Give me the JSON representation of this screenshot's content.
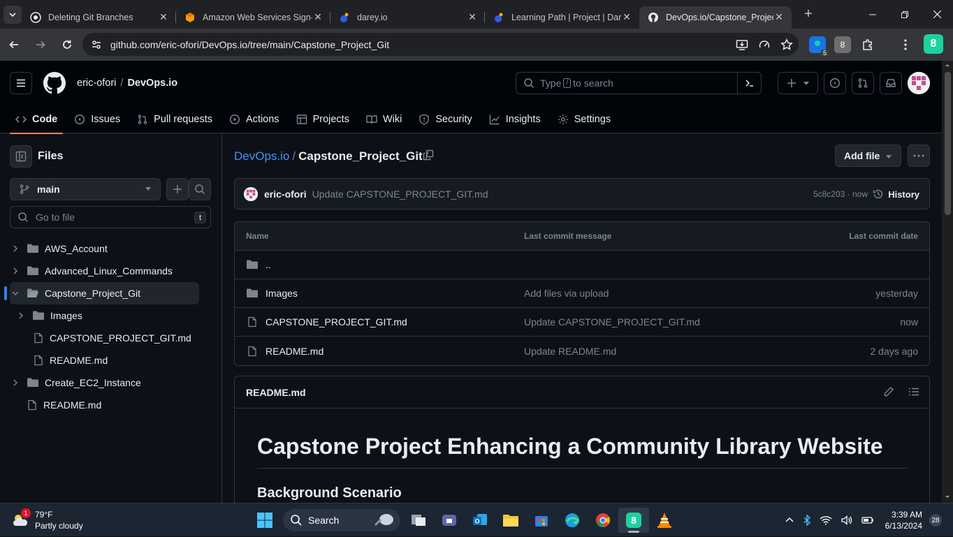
{
  "browser": {
    "tabs": [
      {
        "title": "Deleting Git Branches",
        "icon": "github-icon"
      },
      {
        "title": "Amazon Web Services Sign-In",
        "icon": "aws-icon"
      },
      {
        "title": "darey.io",
        "icon": "darey-icon"
      },
      {
        "title": "Learning Path | Project | Darey",
        "icon": "darey-icon"
      },
      {
        "title": "DevOps.io/Capstone_Project_Git",
        "icon": "github-icon",
        "active": true
      }
    ],
    "url": "github.com/eric-ofori/DevOps.io/tree/main/Capstone_Project_Git",
    "ext_badge": "5",
    "ext2_label": "8",
    "profile_label": "8"
  },
  "header": {
    "owner": "eric-ofori",
    "separator": "/",
    "repo": "DevOps.io",
    "search_prefix": "Type",
    "search_key": "/",
    "search_suffix": "to search"
  },
  "repo_tabs": [
    {
      "label": "Code",
      "icon": "code-icon",
      "active": true
    },
    {
      "label": "Issues",
      "icon": "issues-icon"
    },
    {
      "label": "Pull requests",
      "icon": "pull-request-icon"
    },
    {
      "label": "Actions",
      "icon": "play-icon"
    },
    {
      "label": "Projects",
      "icon": "table-icon"
    },
    {
      "label": "Wiki",
      "icon": "book-icon"
    },
    {
      "label": "Security",
      "icon": "shield-icon"
    },
    {
      "label": "Insights",
      "icon": "graph-icon"
    },
    {
      "label": "Settings",
      "icon": "gear-icon"
    }
  ],
  "sidebar": {
    "title": "Files",
    "branch": "main",
    "goto_placeholder": "Go to file",
    "goto_shortcut": "t",
    "tree": [
      {
        "label": "AWS_Account",
        "type": "folder",
        "depth": 0,
        "expanded": false
      },
      {
        "label": "Advanced_Linux_Commands",
        "type": "folder",
        "depth": 0,
        "expanded": false
      },
      {
        "label": "Capstone_Project_Git",
        "type": "folder",
        "depth": 0,
        "expanded": true,
        "selected": true
      },
      {
        "label": "Images",
        "type": "folder",
        "depth": 1,
        "expanded": false
      },
      {
        "label": "CAPSTONE_PROJECT_GIT.md",
        "type": "file",
        "depth": 1
      },
      {
        "label": "README.md",
        "type": "file",
        "depth": 1
      },
      {
        "label": "Create_EC2_Instance",
        "type": "folder",
        "depth": 0,
        "expanded": false
      },
      {
        "label": "README.md",
        "type": "file",
        "depth": 0
      }
    ]
  },
  "main": {
    "path_repo": "DevOps.io",
    "path_folder": "Capstone_Project_Git",
    "path_sep": "/",
    "add_file_label": "Add file",
    "commit": {
      "user": "eric-ofori",
      "message": "Update CAPSTONE_PROJECT_GIT.md",
      "sha_time": "5c8c203 · now",
      "history_label": "History"
    },
    "table": {
      "headers": [
        "Name",
        "Last commit message",
        "Last commit date"
      ],
      "rows": [
        {
          "name": "..",
          "type": "folder",
          "message": "",
          "date": ""
        },
        {
          "name": "Images",
          "type": "folder",
          "message": "Add files via upload",
          "date": "yesterday"
        },
        {
          "name": "CAPSTONE_PROJECT_GIT.md",
          "type": "file",
          "message": "Update CAPSTONE_PROJECT_GIT.md",
          "date": "now"
        },
        {
          "name": "README.md",
          "type": "file",
          "message": "Update README.md",
          "date": "2 days ago"
        }
      ]
    },
    "readme": {
      "filename": "README.md",
      "h1": "Capstone Project Enhancing a Community Library Website",
      "h2": "Background Scenario"
    }
  },
  "taskbar": {
    "weather_temp": "79°F",
    "weather_desc": "Partly cloudy",
    "weather_badge": "1",
    "search_label": "Search",
    "time": "3:39 AM",
    "date": "6/13/2024",
    "notifications": "28"
  },
  "colors": {
    "accent_blue": "#4493f8",
    "tab_underline": "#f78166",
    "bg": "#0d1117"
  }
}
